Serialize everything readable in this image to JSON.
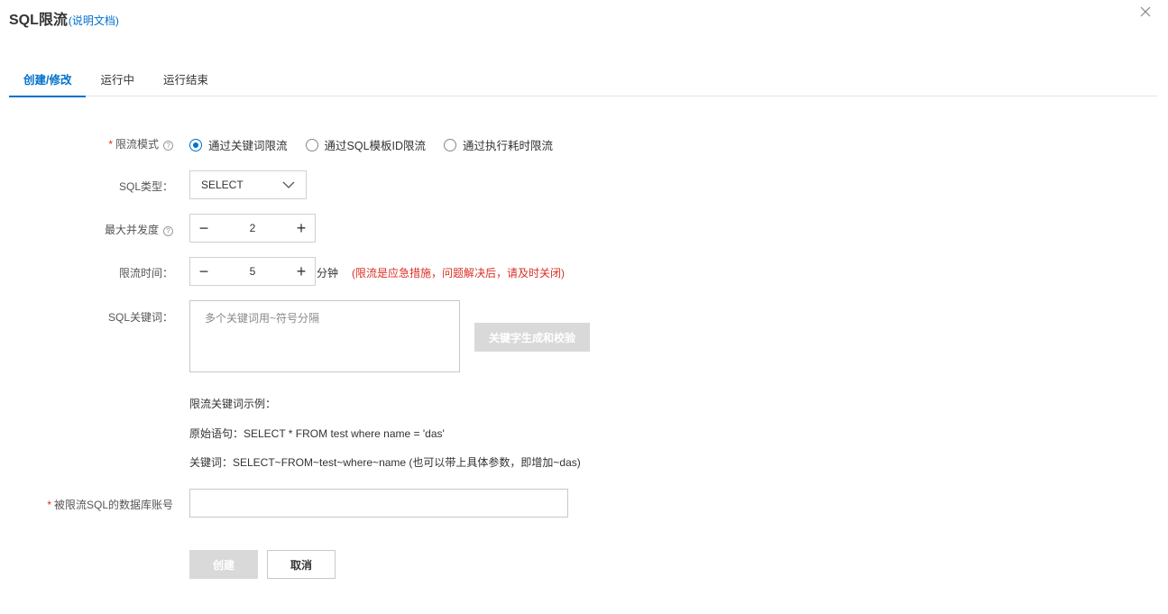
{
  "header": {
    "title": "SQL限流",
    "doc_link": "(说明文档)"
  },
  "tabs": [
    {
      "label": "创建/修改",
      "active": true
    },
    {
      "label": "运行中",
      "active": false
    },
    {
      "label": "运行结束",
      "active": false
    }
  ],
  "form": {
    "mode": {
      "label": "限流模式",
      "options": [
        "通过关键词限流",
        "通过SQL模板ID限流",
        "通过执行耗时限流"
      ],
      "selected": "通过关键词限流"
    },
    "sql_type": {
      "label": "SQL类型：",
      "value": "SELECT"
    },
    "max_concurrency": {
      "label": "最大并发度",
      "value": "2"
    },
    "duration": {
      "label": "限流时间：",
      "value": "5",
      "unit": "分钟",
      "warning": "(限流是应急措施，问题解决后，请及时关闭)"
    },
    "keywords": {
      "label": "SQL关键词：",
      "placeholder": "多个关键词用~符号分隔",
      "generate_button": "关键字生成和校验"
    },
    "example": {
      "title": "限流关键词示例：",
      "original": "原始语句：SELECT * FROM test where name = 'das'",
      "keywords": "关键词：SELECT~FROM~test~where~name (也可以带上具体参数，即增加~das)"
    },
    "db_account": {
      "label": "被限流SQL的数据库账号",
      "value": ""
    }
  },
  "actions": {
    "create": "创建",
    "cancel": "取消"
  },
  "colors": {
    "accent": "#0070cc",
    "warning": "#d93026",
    "disabled": "#d9d9d9"
  }
}
